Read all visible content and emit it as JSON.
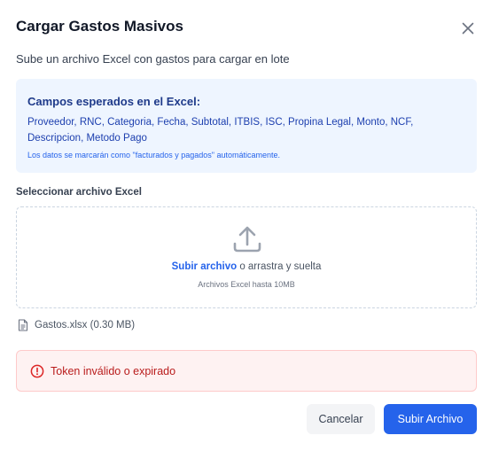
{
  "dialog": {
    "title": "Cargar Gastos Masivos",
    "subtitle": "Sube un archivo Excel con gastos para cargar en lote"
  },
  "info": {
    "title": "Campos esperados en el Excel:",
    "fields": "Proveedor, RNC, Categoria, Fecha, Subtotal, ITBIS, ISC, Propina Legal, Monto, NCF, Descripcion, Metodo Pago",
    "note": "Los datos se marcarán como \"facturados y pagados\" automáticamente."
  },
  "upload": {
    "section_label": "Seleccionar archivo Excel",
    "link_text": "Subir archivo",
    "drag_text": " o arrastra y suelta",
    "hint": "Archivos Excel hasta 10MB"
  },
  "selected_file": {
    "name": "Gastos.xlsx (0.30 MB)"
  },
  "error": {
    "message": "Token inválido o expirado"
  },
  "actions": {
    "cancel_label": "Cancelar",
    "submit_label": "Subir Archivo"
  },
  "colors": {
    "accent": "#2563eb",
    "info_bg": "#eef5ff",
    "error_bg": "#fef2f2",
    "error_text": "#b91c1c"
  },
  "icons": {
    "close": "close-icon",
    "upload": "upload-icon",
    "file": "file-icon",
    "error": "alert-circle-icon"
  }
}
